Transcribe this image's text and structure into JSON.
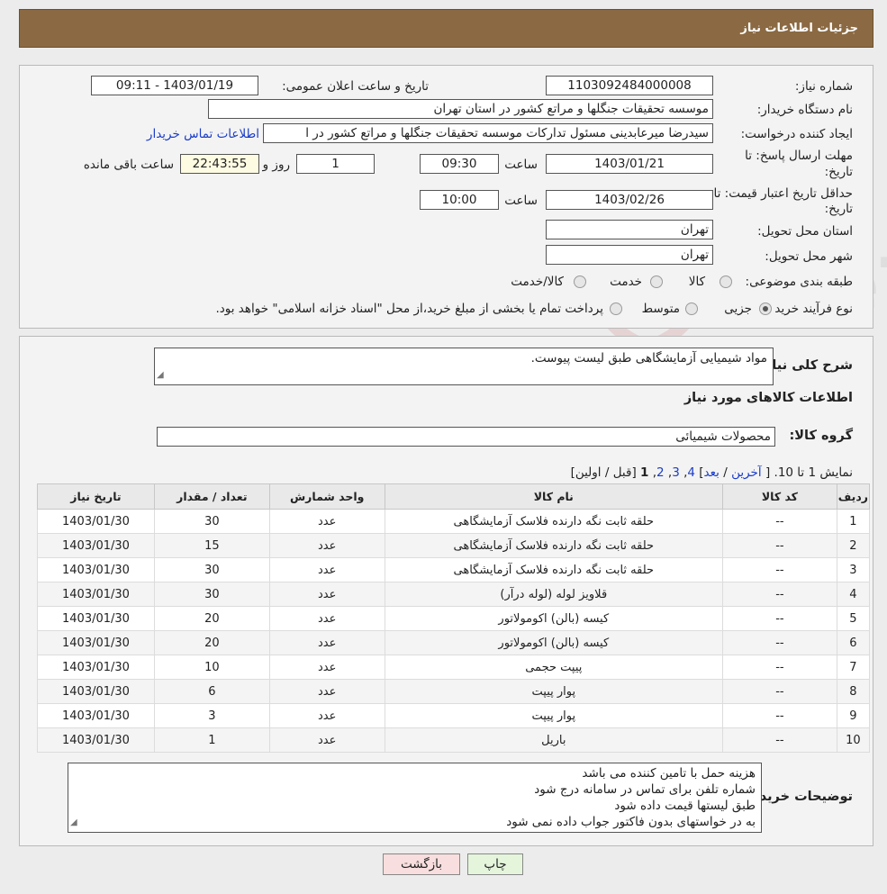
{
  "header": {
    "title": "جزئيات اطلاعات نياز"
  },
  "need": {
    "number_label": "شماره نیاز:",
    "number": "1103092484000008",
    "announce_label": "تاریخ و ساعت اعلان عمومی:",
    "announce_value": "1403/01/19 - 09:11",
    "buyer_org_label": "نام دستگاه خریدار:",
    "buyer_org": "موسسه تحقیقات جنگلها و مراتع کشور در استان تهران",
    "requester_label": "ایجاد کننده درخواست:",
    "requester": "سیدرضا میرعابدینی مسئول تداركات موسسه تحقیقات جنگلها و مراتع كشور در ا",
    "contact_link": "اطلاعات تماس خریدار",
    "deadline_label_1": "مهلت ارسال پاسخ: تا",
    "deadline_label_2": "تاریخ:",
    "deadline_date": "1403/01/21",
    "hour_label": "ساعت",
    "deadline_time": "09:30",
    "days": "1",
    "days_label": "روز و",
    "remaining": "22:43:55",
    "remaining_label": "ساعت باقی مانده",
    "validity_label_1": "حداقل تاریخ اعتبار قیمت: تا",
    "validity_label_2": "تاریخ:",
    "validity_date": "1403/02/26",
    "validity_time": "10:00",
    "province_label": "استان محل تحویل:",
    "province": "تهران",
    "city_label": "شهر محل تحویل:",
    "city": "تهران",
    "category_label": "طبقه بندی موضوعی:",
    "category_options": [
      "کالا",
      "خدمت",
      "کالا/خدمت"
    ],
    "process_label": "نوع فرآیند خرید :",
    "process_options": [
      "جزیی",
      "متوسط"
    ],
    "process_note": "پرداخت تمام یا بخشی از مبلغ خرید،از محل \"اسناد خزانه اسلامی\" خواهد بود."
  },
  "description": {
    "label": "شرح کلی نیاز:",
    "value": "مواد شیمیایی آزمایشگاهی طبق لیست پیوست."
  },
  "goods": {
    "section_title": "اطلاعات کالاهای مورد نیاز",
    "group_label": "گروه کالا:",
    "group_value": "محصولات شیمیائی"
  },
  "pagination": {
    "showing": "نمایش 1 تا 10.",
    "open": "[",
    "last": "آخرین",
    "next": "بعد",
    "pages": [
      "4",
      "3",
      "2"
    ],
    "current": "1",
    "tail": "[قبل / اولین]",
    "sep": "/",
    "comma": ","
  },
  "table": {
    "headers": [
      "ردیف",
      "کد کالا",
      "نام کالا",
      "واحد شمارش",
      "تعداد / مقدار",
      "تاریخ نیاز"
    ],
    "rows": [
      [
        "1",
        "--",
        "حلقه ثابت نگه دارنده فلاسک آزمایشگاهی",
        "عدد",
        "30",
        "1403/01/30"
      ],
      [
        "2",
        "--",
        "حلقه ثابت نگه دارنده فلاسک آزمایشگاهی",
        "عدد",
        "15",
        "1403/01/30"
      ],
      [
        "3",
        "--",
        "حلقه ثابت نگه دارنده فلاسک آزمایشگاهی",
        "عدد",
        "30",
        "1403/01/30"
      ],
      [
        "4",
        "--",
        "قلاویز لوله (لوله درآر)",
        "عدد",
        "30",
        "1403/01/30"
      ],
      [
        "5",
        "--",
        "کیسه (بالن) اکومولاتور",
        "عدد",
        "20",
        "1403/01/30"
      ],
      [
        "6",
        "--",
        "کیسه (بالن) اکومولاتور",
        "عدد",
        "20",
        "1403/01/30"
      ],
      [
        "7",
        "--",
        "پیپت حجمی",
        "عدد",
        "10",
        "1403/01/30"
      ],
      [
        "8",
        "--",
        "پوار پیپت",
        "عدد",
        "6",
        "1403/01/30"
      ],
      [
        "9",
        "--",
        "پوار پیپت",
        "عدد",
        "3",
        "1403/01/30"
      ],
      [
        "10",
        "--",
        "باریل",
        "عدد",
        "1",
        "1403/01/30"
      ]
    ]
  },
  "buyer_notes": {
    "label": "توضیحات خریدار:",
    "lines": [
      "هزینه حمل با تامین کننده می باشد",
      "شماره تلفن برای تماس در سامانه درج شود",
      "طبق لیستها قیمت داده شود",
      "به در خواستهای بدون فاکتور جواب داده نمی شود"
    ]
  },
  "buttons": {
    "print": "چاپ",
    "back": "بازگشت"
  },
  "watermark": {
    "text": "AriaTender.neT"
  },
  "colors": {
    "header_bg": "#8b6a43",
    "link": "#1a3cc8",
    "back_btn": "#f8dede",
    "print_btn": "#e4f5dc"
  }
}
